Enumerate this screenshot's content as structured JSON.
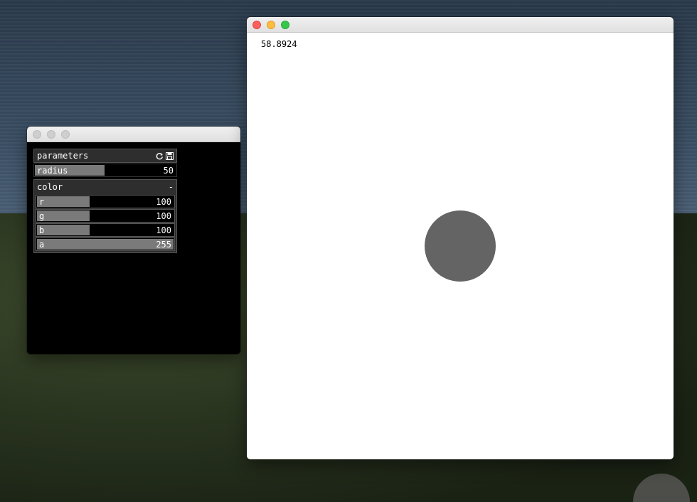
{
  "desktop": {
    "wallpaper": "coastal landscape"
  },
  "panel_window": {
    "gui": {
      "header": {
        "label": "parameters",
        "icons": [
          "reload-icon",
          "save-icon"
        ]
      },
      "radius": {
        "label": "radius",
        "value": "50",
        "fraction": 0.5
      },
      "color_group": {
        "label": "color",
        "toggle": "-",
        "r": {
          "label": "r",
          "value": "100",
          "fraction": 0.392
        },
        "g": {
          "label": "g",
          "value": "100",
          "fraction": 0.392
        },
        "b": {
          "label": "b",
          "value": "100",
          "fraction": 0.392
        },
        "a": {
          "label": "a",
          "value": "255",
          "fraction": 1.0
        }
      }
    }
  },
  "render_window": {
    "fps": "58.8924",
    "circle": {
      "radius": 50,
      "color": "#646464"
    }
  },
  "colors": {
    "close": "#fc605c",
    "minimize": "#fdbc40",
    "maximize": "#34c84a",
    "slider_fill": "#7a7a7a",
    "panel_bg": "#000000",
    "canvas_bg": "#ffffff"
  }
}
